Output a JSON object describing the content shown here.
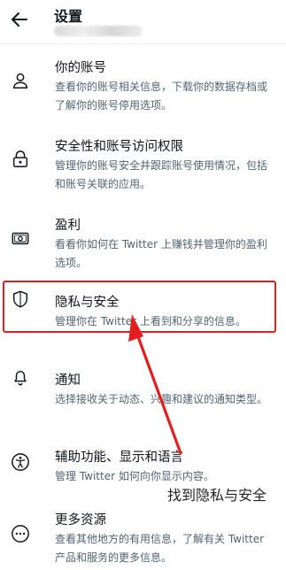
{
  "header": {
    "title": "设置"
  },
  "items": [
    {
      "label": "你的账号",
      "desc": "查看你的账号相关信息，下载你的数据存档或了解你的账号停用选项。"
    },
    {
      "label": "安全性和账号访问权限",
      "desc": "管理你的账号安全并跟踪账号使用情况，包括和账号关联的应用。"
    },
    {
      "label": "盈利",
      "desc": "看看你如何在 Twitter 上赚钱并管理你的盈利选项。"
    },
    {
      "label": "隐私与安全",
      "desc": "管理你在 Twitter 上看到和分享的信息。"
    },
    {
      "label": "通知",
      "desc": "选择接收关于动态、兴趣和建议的通知类型。"
    },
    {
      "label": "辅助功能、显示和语言",
      "desc": "管理 Twitter 如何向你显示内容。"
    },
    {
      "label": "更多资源",
      "desc": "查看其他地方的有用信息，了解有关 Twitter 产品和服务的更多信息。"
    }
  ],
  "annotation": {
    "text": "找到隐私与安全",
    "color": "#e41e1e"
  },
  "icons": [
    "back-arrow-icon",
    "user-icon",
    "lock-icon",
    "money-icon",
    "shield-icon",
    "bell-icon",
    "accessibility-icon",
    "more-icon"
  ]
}
